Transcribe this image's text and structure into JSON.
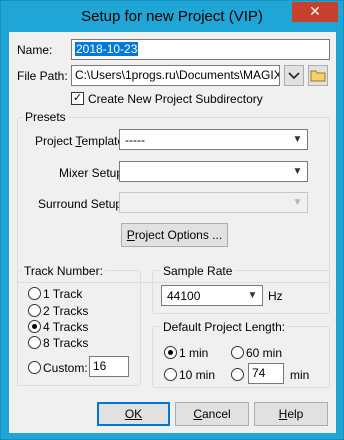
{
  "window": {
    "title": "Setup for new Project (VIP)",
    "close_glyph": "✕"
  },
  "name": {
    "label": "Name:",
    "value": "2018-10-23"
  },
  "file_path": {
    "label": "File Path:",
    "value": "C:\\Users\\1progs.ru\\Documents\\MAGIX\\S"
  },
  "create_subdir": {
    "label": "Create New Project Subdirectory",
    "checked": true
  },
  "presets": {
    "title": "Presets",
    "project_template_label": "Project Template:",
    "project_template_value": "-----",
    "mixer_setup_label": "Mixer Setup:",
    "mixer_setup_value": "",
    "surround_setup_label": "Surround Setup:",
    "surround_setup_value": "",
    "project_options_button": "Project Options ..."
  },
  "track_number": {
    "title": "Track Number:",
    "options": [
      "1 Track",
      "2 Tracks",
      "4 Tracks",
      "8 Tracks"
    ],
    "selected": "4 Tracks",
    "custom_label": "Custom:",
    "custom_value": "16"
  },
  "sample_rate": {
    "title": "Sample Rate",
    "value": "44100",
    "unit": "Hz"
  },
  "project_length": {
    "title": "Default Project Length:",
    "opt_1": "1 min",
    "opt_60": "60 min",
    "opt_10": "10 min",
    "custom_value": "74",
    "custom_unit": "min",
    "selected": "1 min"
  },
  "buttons": {
    "ok": "OK",
    "cancel": "Cancel",
    "help": "Help"
  }
}
